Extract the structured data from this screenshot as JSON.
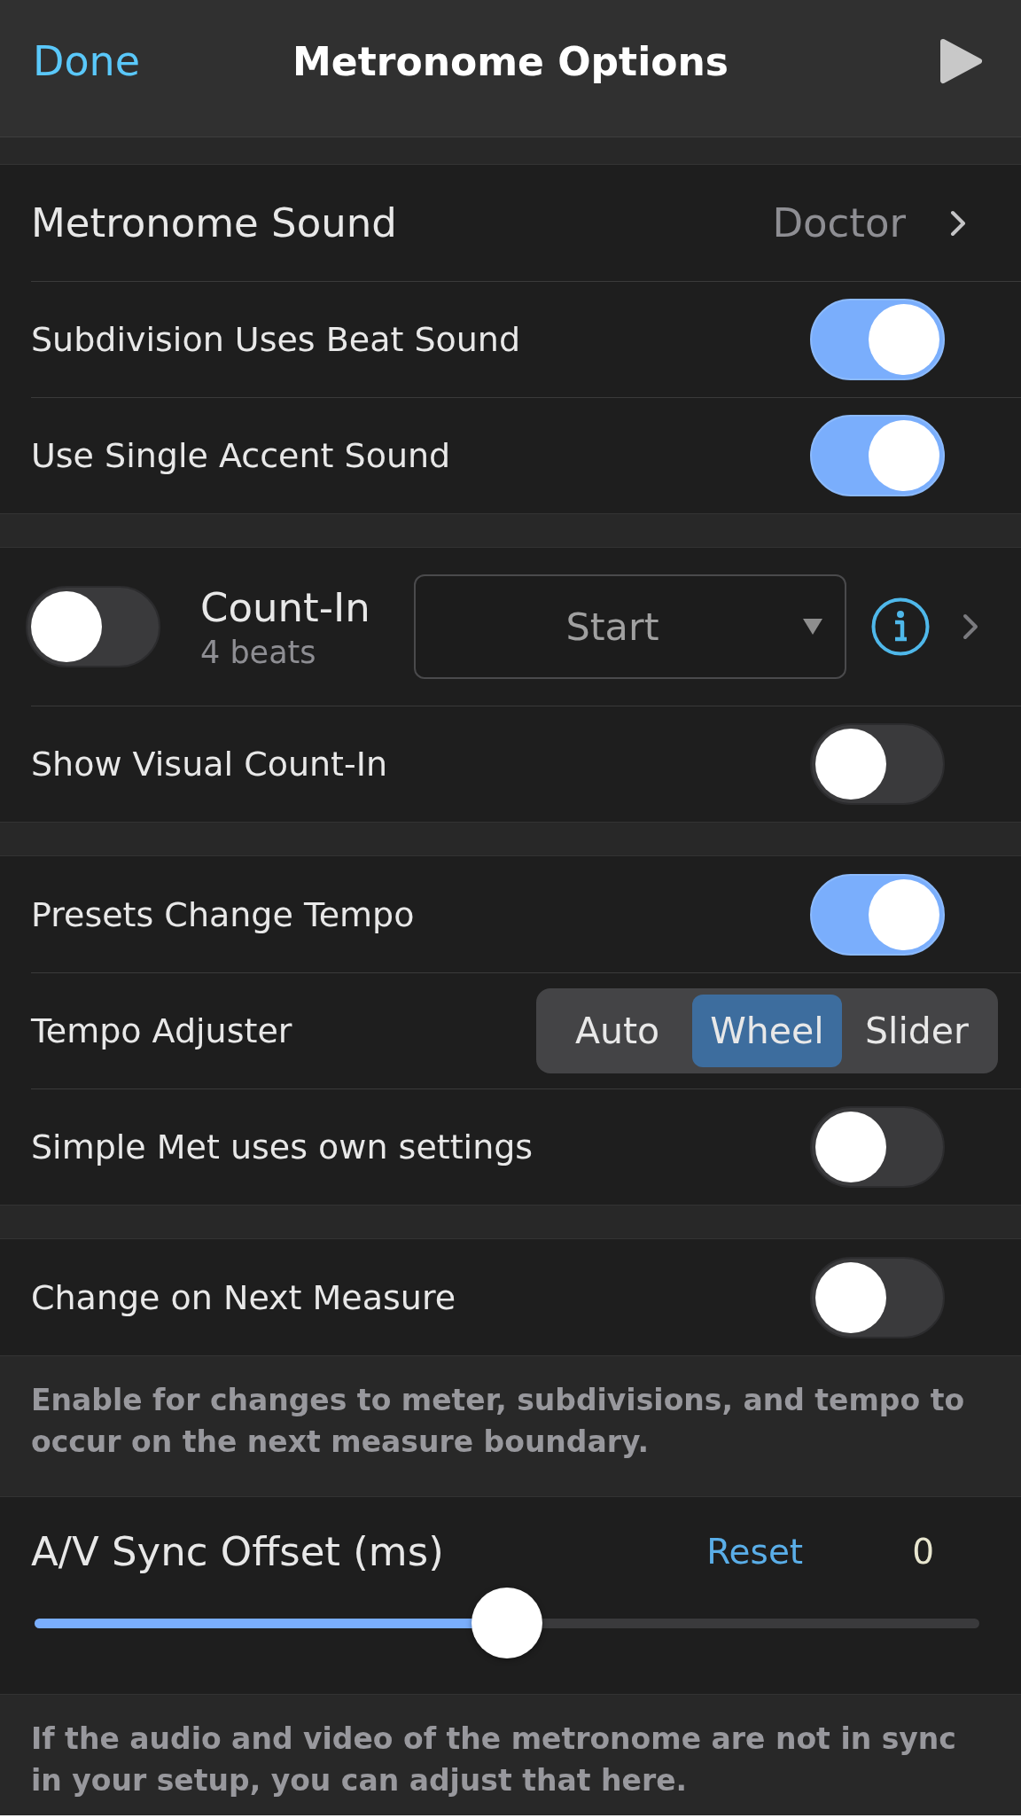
{
  "header": {
    "done": "Done",
    "title": "Metronome Options"
  },
  "sections": [
    {
      "rows": [
        {
          "kind": "link",
          "label": "Metronome Sound",
          "value": "Doctor"
        },
        {
          "kind": "toggle",
          "label": "Subdivision Uses Beat Sound",
          "on": true
        },
        {
          "kind": "toggle",
          "label": "Use Single Accent Sound",
          "on": true
        }
      ]
    },
    {
      "rows": [
        {
          "kind": "count_in",
          "label": "Count-In",
          "sublabel": "4 beats",
          "on": false,
          "dropdown": "Start"
        },
        {
          "kind": "toggle",
          "label": "Show Visual Count-In",
          "on": false
        }
      ]
    },
    {
      "rows": [
        {
          "kind": "toggle",
          "label": "Presets Change Tempo",
          "on": true
        },
        {
          "kind": "segmented",
          "label": "Tempo Adjuster",
          "options": [
            {
              "label": "Auto",
              "selected": false
            },
            {
              "label": "Wheel",
              "selected": true
            },
            {
              "label": "Slider",
              "selected": false
            }
          ]
        },
        {
          "kind": "toggle",
          "label": "Simple Met uses own settings",
          "on": false
        }
      ]
    },
    {
      "rows": [
        {
          "kind": "toggle",
          "label": "Change on Next Measure",
          "on": false
        }
      ],
      "footer": "Enable for changes to meter, subdivisions, and tempo to occur on the next measure boundary."
    },
    {
      "rows": [
        {
          "kind": "slider",
          "label": "A/V Sync Offset (ms)",
          "action": "Reset",
          "reading": "0",
          "level": 0.5
        }
      ],
      "footer": "If the audio and video of the metronome are not in sync in your setup, you can adjust that here."
    }
  ]
}
